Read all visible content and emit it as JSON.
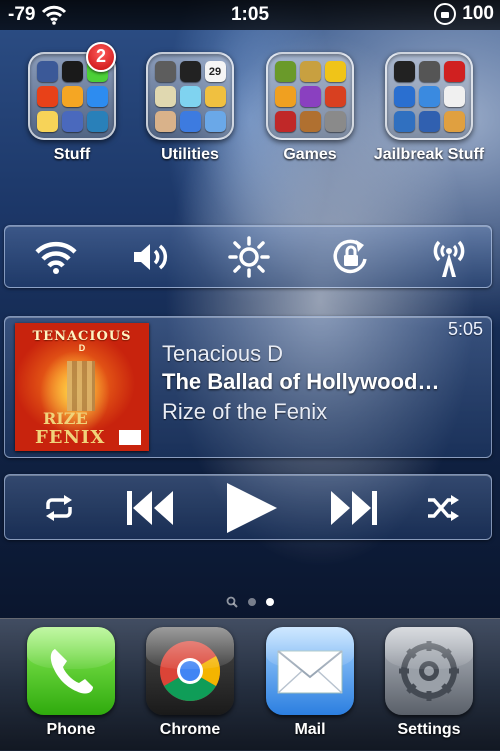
{
  "status_bar": {
    "signal": "-79",
    "time": "1:05",
    "battery": "100",
    "icons": [
      "wifi-icon",
      "rotation-lock-icon"
    ]
  },
  "folders": [
    {
      "label": "Stuff",
      "badge": "2",
      "apps": [
        "#3b5998",
        "#1a1a1a",
        "#4cd137",
        "#e84118",
        "#f5a623",
        "#2d8cf0",
        "#f7d358",
        "#4a69bd",
        "#2980b9"
      ]
    },
    {
      "label": "Utilities",
      "badge": "",
      "apps": [
        "#5d5d5d",
        "#222222",
        "#f5f5f5",
        "#e0d8b0",
        "#7fd3f0",
        "#f0c040",
        "#d9b28a",
        "#3d7be0",
        "#6aa8e8"
      ]
    },
    {
      "label": "Games",
      "badge": "",
      "apps": [
        "#6a9a2a",
        "#c8a040",
        "#f0c418",
        "#f0a020",
        "#8a40c0",
        "#d84020",
        "#c02828",
        "#b07030",
        "#8a8a8a"
      ]
    },
    {
      "label": "Jailbreak Stuff",
      "badge": "",
      "apps": [
        "#222222",
        "#555555",
        "#d02020",
        "#2a6fd0",
        "#3a8ae0",
        "#f0f0f0",
        "#3070c0",
        "#3060b0",
        "#e0a040"
      ]
    }
  ],
  "toggles": [
    {
      "name": "wifi-toggle",
      "icon": "wifi-icon"
    },
    {
      "name": "volume-toggle",
      "icon": "volume-icon"
    },
    {
      "name": "brightness-toggle",
      "icon": "brightness-icon"
    },
    {
      "name": "rotation-lock-toggle",
      "icon": "rotation-lock-icon"
    },
    {
      "name": "cellular-toggle",
      "icon": "antenna-icon"
    }
  ],
  "now_playing": {
    "duration": "5:05",
    "artist": "Tenacious D",
    "title": "The Ballad of Hollywood…",
    "album": "Rize of the Fenix",
    "art": {
      "band": "TENACIOUS",
      "d": "D",
      "line1": "RIZE",
      "line2": "FENIX",
      "of": "of the"
    }
  },
  "controls": [
    "repeat-icon",
    "previous-icon",
    "play-icon",
    "next-icon",
    "shuffle-icon"
  ],
  "page_dots": {
    "count": 2,
    "active": 1,
    "search": "search-icon"
  },
  "dock": [
    {
      "label": "Phone",
      "icon": "phone-icon"
    },
    {
      "label": "Chrome",
      "icon": "chrome-icon"
    },
    {
      "label": "Mail",
      "icon": "mail-icon"
    },
    {
      "label": "Settings",
      "icon": "settings-icon"
    }
  ],
  "colors": {
    "badge": "#d11414",
    "panel_border": "#d2e1ff"
  }
}
